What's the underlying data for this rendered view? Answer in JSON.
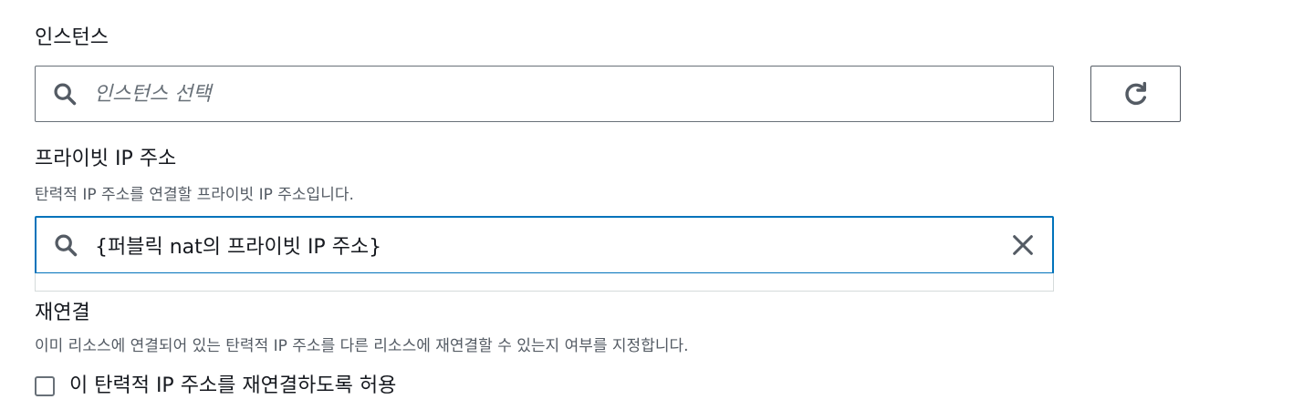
{
  "instance": {
    "label": "인스턴스",
    "search_placeholder": "인스턴스 선택",
    "search_value": ""
  },
  "private_ip": {
    "label": "프라이빗 IP 주소",
    "description": "탄력적 IP 주소를 연결할 프라이빗 IP 주소입니다.",
    "search_value": "{퍼블릭 nat의 프라이빗 IP 주소}"
  },
  "reassociation": {
    "label": "재연결",
    "description": "이미 리소스에 연결되어 있는 탄력적 IP 주소를 다른 리소스에 재연결할 수 있는지 여부를 지정합니다.",
    "checkbox_label": "이 탄력적 IP 주소를 재연결하도록 허용",
    "checked": false
  },
  "icons": {
    "search": "search-icon",
    "refresh": "refresh-icon",
    "clear": "close-icon"
  },
  "colors": {
    "focus_border": "#0073bb",
    "text": "#16191f",
    "secondary_text": "#545b64"
  }
}
